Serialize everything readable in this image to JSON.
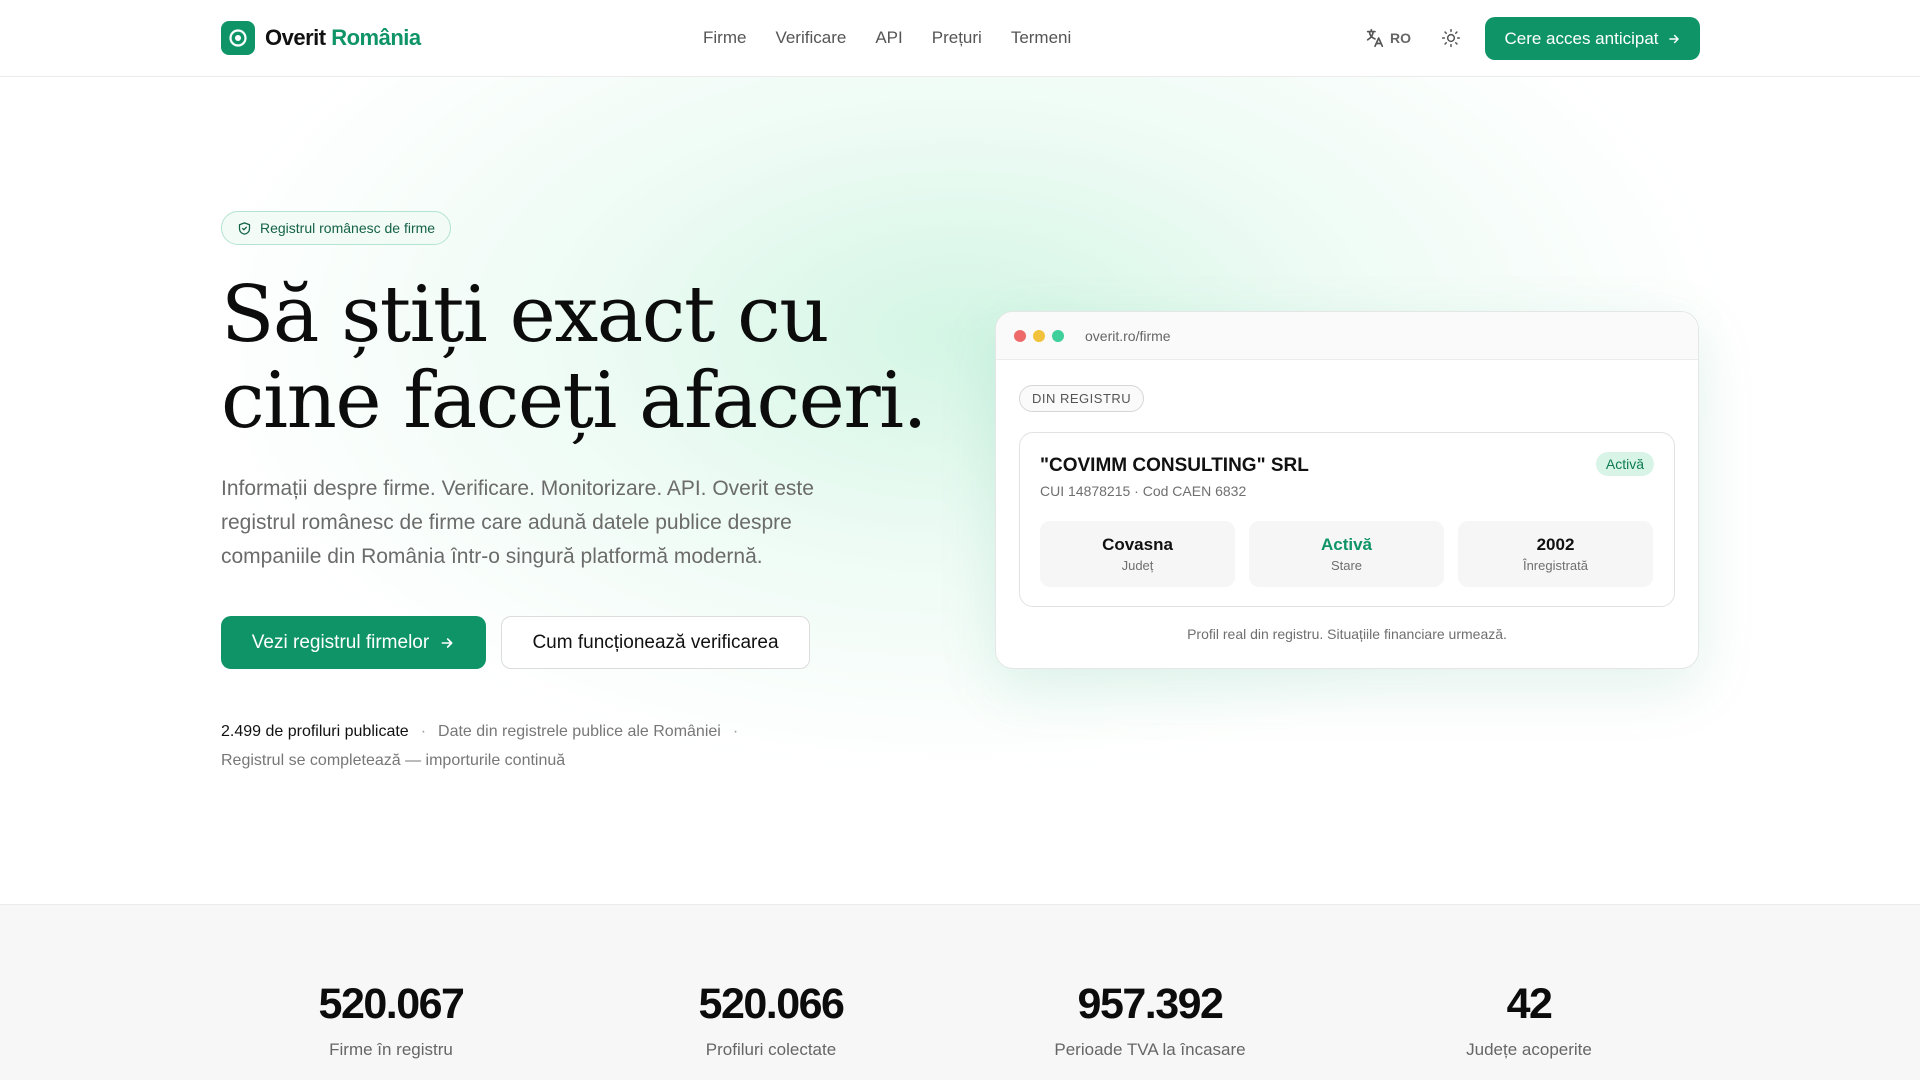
{
  "brand": {
    "name": "Overit",
    "name_accent": "România",
    "primary_color": "#0e9467"
  },
  "nav": {
    "items": [
      "Firme",
      "Verificare",
      "API",
      "Prețuri",
      "Termeni"
    ]
  },
  "header": {
    "language": "RO",
    "language_icon": "translate-icon",
    "theme_icon": "sun-icon",
    "cta_label": "Cere acces anticipat"
  },
  "hero": {
    "badge": "Registrul românesc de firme",
    "badge_icon": "shield-check-icon",
    "title_line1": "Să știți exact cu",
    "title_line2": "cine faceți afaceri.",
    "subtitle": "Informații despre firme. Verificare. Monitorizare. API. Overit este registrul românesc de firme care adună datele publice despre companiile din România într-o singură platformă modernă.",
    "primary_button": "Vezi registrul firmelor",
    "secondary_button": "Cum funcționează verificarea",
    "meta_profiles": "2.499 de profiluri publicate",
    "meta_sources": "Date din registrele publice ale României",
    "meta_status": "Registrul se completează — importurile continuă"
  },
  "preview": {
    "url": "overit.ro/firme",
    "section_pill": "DIN REGISTRU",
    "company_name": "\"COVIMM CONSULTING\" SRL",
    "company_meta": "CUI 14878215 · Cod CAEN 6832",
    "status_badge": "Activă",
    "stats": [
      {
        "value": "Covasna",
        "label": "Județ"
      },
      {
        "value": "Activă",
        "label": "Stare"
      },
      {
        "value": "2002",
        "label": "Înregistrată"
      }
    ],
    "footer": "Profil real din registru. Situațiile financiare urmează.",
    "window_dot_colors": [
      "#ef6b6b",
      "#f2c23c",
      "#3fcf9a"
    ]
  },
  "stats": [
    {
      "value": "520.067",
      "label": "Firme în registru"
    },
    {
      "value": "520.066",
      "label": "Profiluri colectate"
    },
    {
      "value": "957.392",
      "label": "Perioade TVA la încasare"
    },
    {
      "value": "42",
      "label": "Județe acoperite"
    }
  ]
}
